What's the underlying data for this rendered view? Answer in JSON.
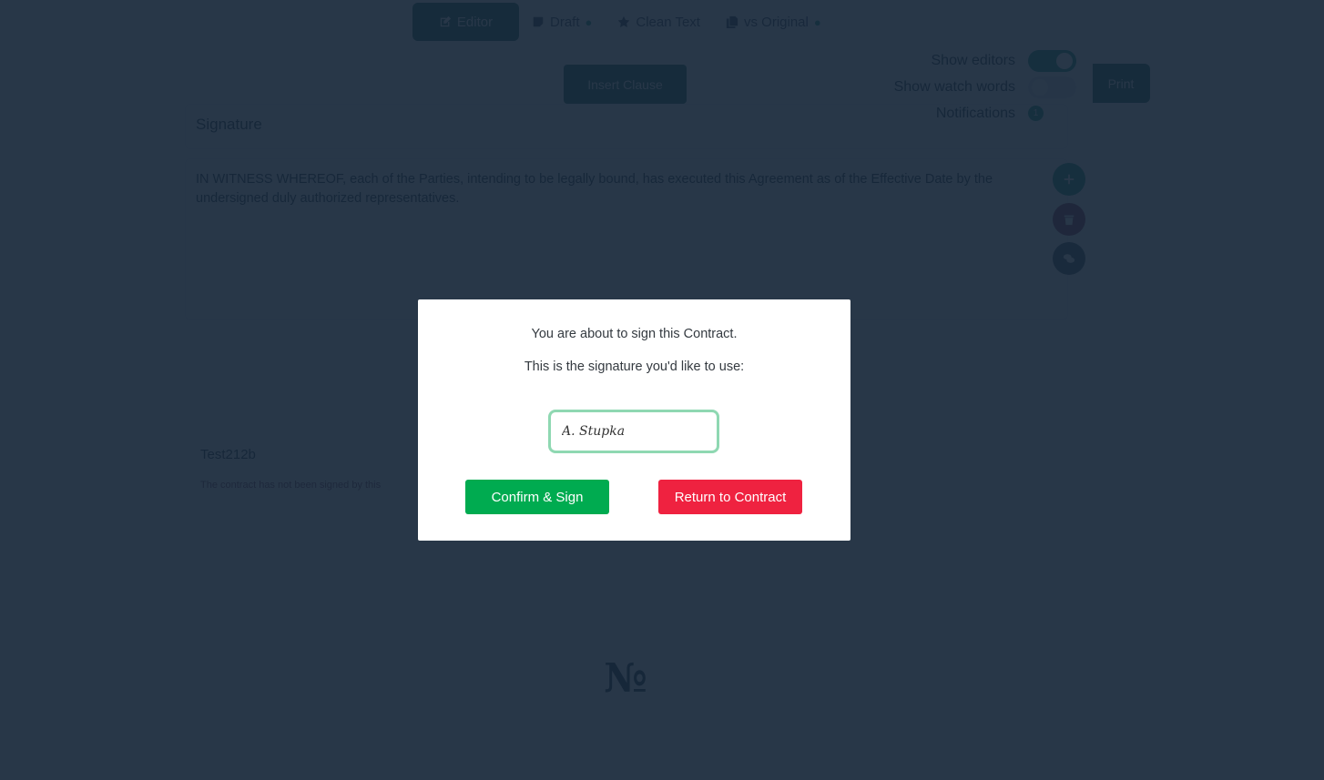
{
  "tabs": [
    {
      "label": "Editor",
      "icon": "edit-icon",
      "active": true
    },
    {
      "label": "Draft",
      "icon": "sticky-note-icon",
      "badge_icon": "lightbulb-icon",
      "active": false
    },
    {
      "label": "Clean Text",
      "icon": "star-icon",
      "active": false
    },
    {
      "label": "vs Original",
      "icon": "copy-icon",
      "badge_icon": "lightbulb-icon",
      "active": false
    }
  ],
  "toolbar": {
    "insert_clause_label": "Insert Clause",
    "print_label": "Print"
  },
  "toggles": {
    "show_editors": {
      "label": "Show editors",
      "on": true
    },
    "show_watch_words": {
      "label": "Show watch words",
      "on": false
    },
    "notifications": {
      "label": "Notifications",
      "count": "1"
    }
  },
  "section": {
    "title": "Signature",
    "clause_text": "IN WITNESS WHEREOF, each of the Parties, intending to be legally bound, has executed this Agreement as of the Effective Date by the undersigned duly authorized representatives."
  },
  "side_actions": {
    "add": "plus-icon",
    "delete": "trash-icon",
    "comment": "comments-icon"
  },
  "signer": {
    "name": "Test212b",
    "status": "The contract has not been signed by this"
  },
  "modal": {
    "line1": "You are about to sign this Contract.",
    "line2": "This is the signature you'd like to use:",
    "signature_value": "A. Stupka",
    "confirm_label": "Confirm & Sign",
    "return_label": "Return to Contract"
  },
  "colors": {
    "brand": "#01514d",
    "accent": "#018b70",
    "confirm": "#00ab50",
    "danger": "#ef2240",
    "input_focus": "#8fd8b2",
    "overlay": "#1c2e40"
  }
}
